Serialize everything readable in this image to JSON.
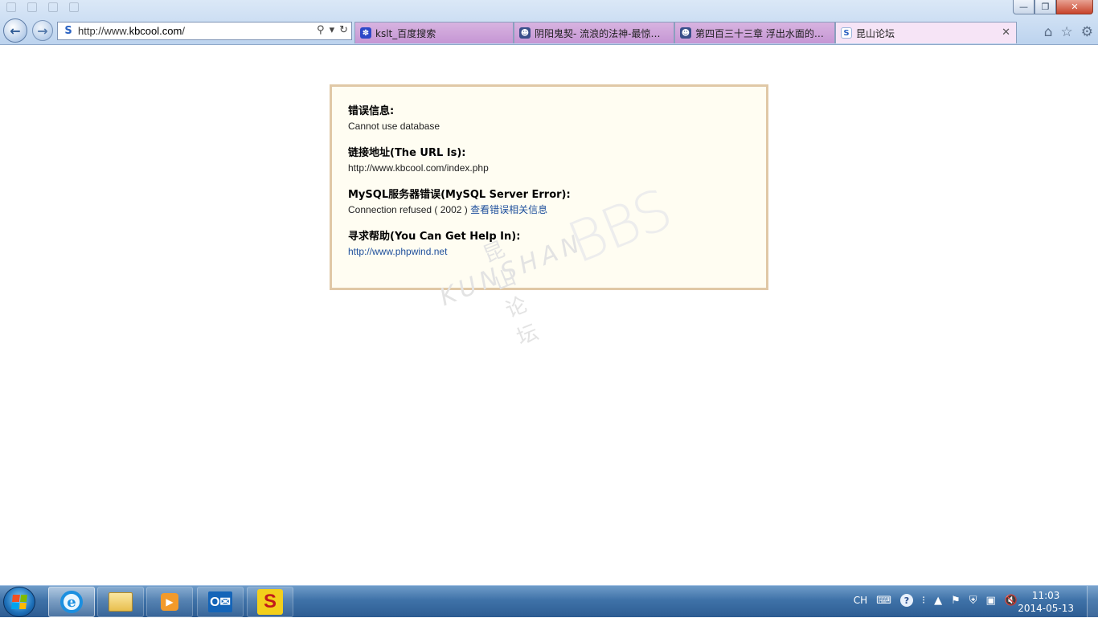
{
  "browser": {
    "address": {
      "url_prefix": "http://www.",
      "url_domain": "kbcool.com",
      "url_suffix": "/",
      "favicon": "S"
    },
    "window_buttons": {
      "minimize": "—",
      "restore": "❐",
      "close": "✕"
    },
    "tabs": [
      {
        "label": "kslt_百度搜索",
        "icon": "baidu-paw-icon",
        "active": false
      },
      {
        "label": "阴阳鬼契- 流浪的法神-最惊悚-...",
        "icon": "skull-icon",
        "active": false
      },
      {
        "label": "第四百三十三章 浮出水面的黑...",
        "icon": "skull-icon",
        "active": false
      },
      {
        "label": "昆山论坛",
        "icon": "site-s-icon",
        "active": true
      }
    ],
    "tab_close": "✕",
    "toolbar_icons": {
      "home": "⌂",
      "favorites": "☆",
      "tools": "⚙"
    }
  },
  "error_page": {
    "sections": [
      {
        "title": "错误信息:",
        "body": "Cannot use database"
      },
      {
        "title": "链接地址(The URL Is):",
        "body": "http://www.kbcool.com/index.php"
      },
      {
        "title": "MySQL服务器错误(MySQL Server Error):",
        "body": "Connection refused ( 2002 )",
        "link": "查看错误相关信息"
      },
      {
        "title": "寻求帮助(You Can Get Help In):",
        "link": "http://www.phpwind.net"
      }
    ],
    "watermark": {
      "chinese": "昆山论坛",
      "english": "KUNSHAN",
      "bbs": "BBS"
    }
  },
  "taskbar": {
    "apps": [
      {
        "name": "Internet Explorer",
        "icon": "ie-icon",
        "active": true
      },
      {
        "name": "Windows Explorer",
        "icon": "folder-icon",
        "active": false
      },
      {
        "name": "Media Player",
        "icon": "media-player-icon",
        "active": false
      },
      {
        "name": "Outlook",
        "icon": "outlook-icon",
        "active": false
      },
      {
        "name": "S App",
        "icon": "s-app-icon",
        "active": false
      }
    ],
    "tray": {
      "lang": "CH",
      "help": "?"
    },
    "clock": {
      "time": "11:03",
      "date": "2014-05-13"
    }
  }
}
